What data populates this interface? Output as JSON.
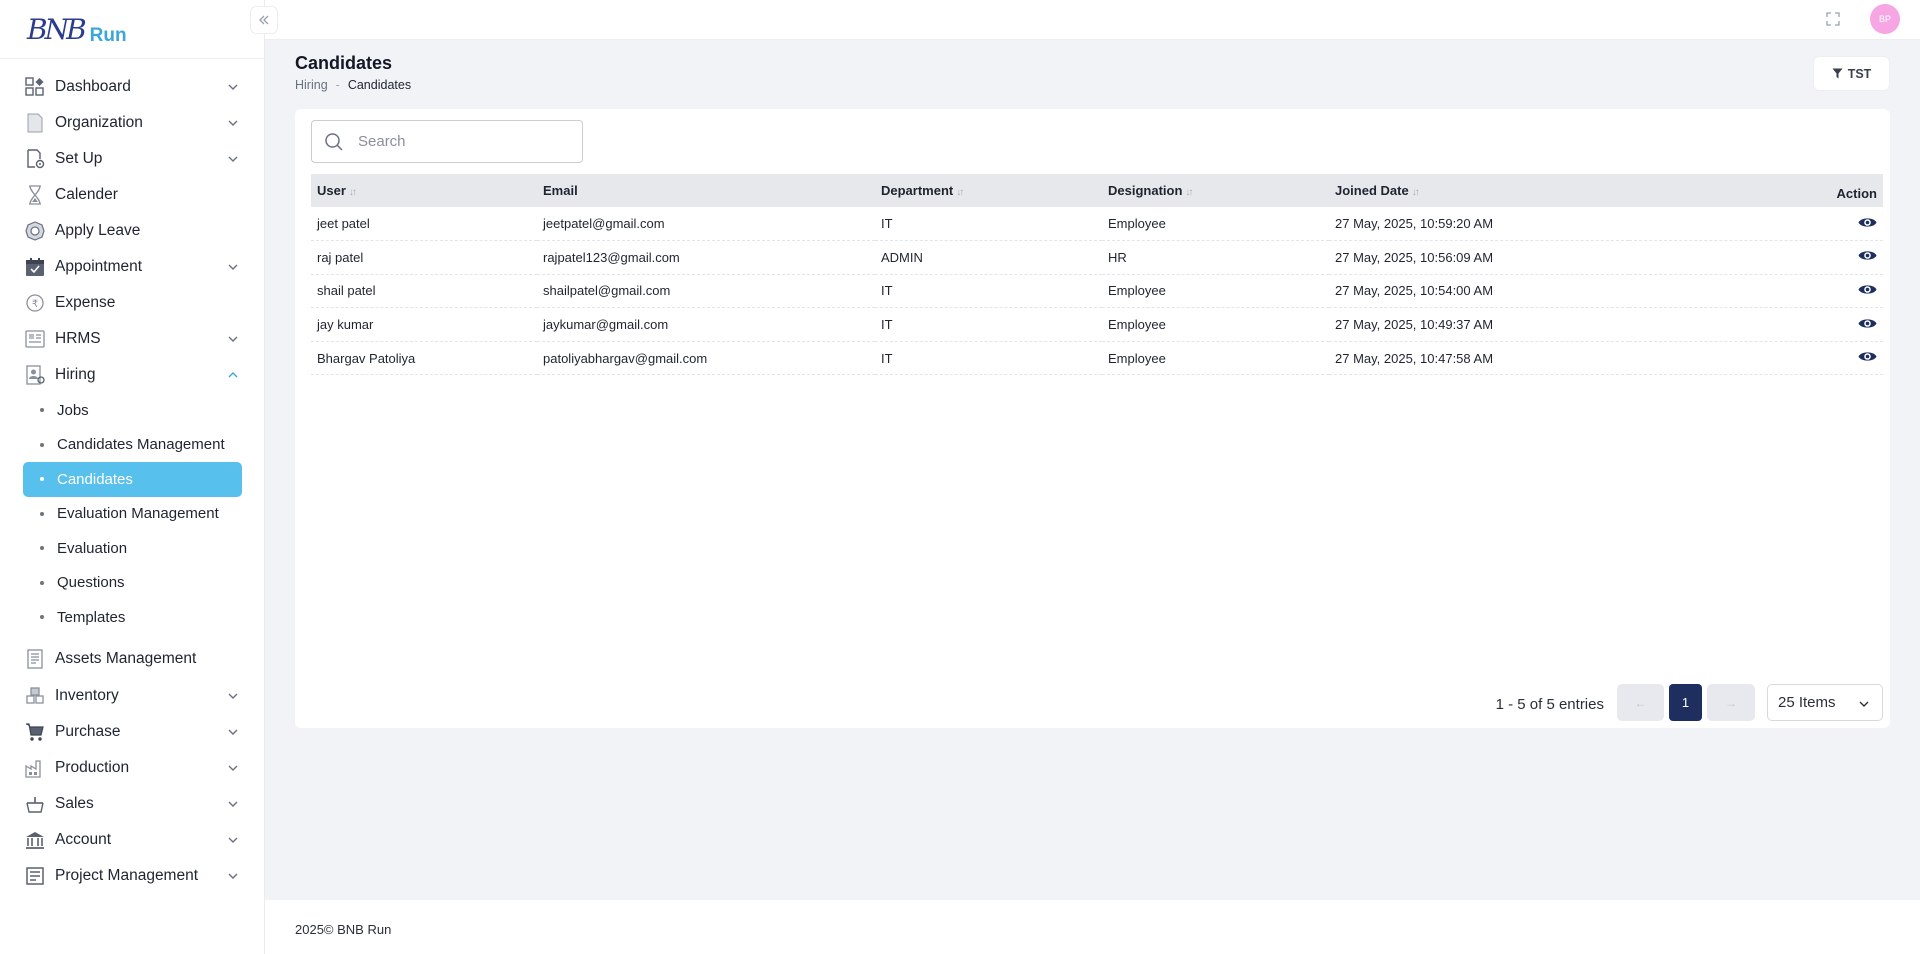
{
  "brand": {
    "mark": "BNB",
    "name": "Run"
  },
  "sidebar": {
    "items": [
      {
        "label": "Dashboard",
        "icon": "dashboard-icon",
        "has_chevron": true
      },
      {
        "label": "Organization",
        "icon": "organization-icon",
        "has_chevron": true
      },
      {
        "label": "Set Up",
        "icon": "setup-icon",
        "has_chevron": true
      },
      {
        "label": "Calender",
        "icon": "hourglass-icon",
        "has_chevron": false
      },
      {
        "label": "Apply Leave",
        "icon": "leave-icon",
        "has_chevron": false
      },
      {
        "label": "Appointment",
        "icon": "calendar-icon",
        "has_chevron": true
      },
      {
        "label": "Expense",
        "icon": "expense-icon",
        "has_chevron": false
      },
      {
        "label": "HRMS",
        "icon": "hrms-icon",
        "has_chevron": true
      },
      {
        "label": "Hiring",
        "icon": "hiring-icon",
        "has_chevron": true,
        "expanded": true
      }
    ],
    "hiring_sub": [
      {
        "label": "Jobs"
      },
      {
        "label": "Candidates Management"
      },
      {
        "label": "Candidates",
        "active": true
      },
      {
        "label": "Evaluation Management"
      },
      {
        "label": "Evaluation"
      },
      {
        "label": "Questions"
      },
      {
        "label": "Templates"
      }
    ],
    "items_after": [
      {
        "label": "Assets Management",
        "icon": "assets-icon",
        "has_chevron": false
      },
      {
        "label": "Inventory",
        "icon": "inventory-icon",
        "has_chevron": true
      },
      {
        "label": "Purchase",
        "icon": "cart-icon",
        "has_chevron": true
      },
      {
        "label": "Production",
        "icon": "factory-icon",
        "has_chevron": true
      },
      {
        "label": "Sales",
        "icon": "sales-icon",
        "has_chevron": true
      },
      {
        "label": "Account",
        "icon": "bank-icon",
        "has_chevron": true
      },
      {
        "label": "Project Management",
        "icon": "project-icon",
        "has_chevron": true
      }
    ]
  },
  "topbar": {
    "avatar_initials": "BP",
    "avatar_color": "#f5a6e3"
  },
  "page": {
    "title": "Candidates",
    "breadcrumb": {
      "parent": "Hiring",
      "separator": "-",
      "current": "Candidates"
    },
    "filter_label": "TST"
  },
  "search": {
    "placeholder": "Search",
    "value": ""
  },
  "table": {
    "columns": [
      "User",
      "Email",
      "Department",
      "Designation",
      "Joined Date",
      "Action"
    ],
    "rows": [
      {
        "user": "jeet patel",
        "email": "jeetpatel@gmail.com",
        "department": "IT",
        "designation": "Employee",
        "joined": "27 May, 2025, 10:59:20 AM"
      },
      {
        "user": "raj patel",
        "email": "rajpatel123@gmail.com",
        "department": "ADMIN",
        "designation": "HR",
        "joined": "27 May, 2025, 10:56:09 AM"
      },
      {
        "user": "shail patel",
        "email": "shailpatel@gmail.com",
        "department": "IT",
        "designation": "Employee",
        "joined": "27 May, 2025, 10:54:00 AM"
      },
      {
        "user": "jay kumar",
        "email": "jaykumar@gmail.com",
        "department": "IT",
        "designation": "Employee",
        "joined": "27 May, 2025, 10:49:37 AM"
      },
      {
        "user": "Bhargav Patoliya",
        "email": "patoliyabhargav@gmail.com",
        "department": "IT",
        "designation": "Employee",
        "joined": "27 May, 2025, 10:47:58 AM"
      }
    ]
  },
  "pagination": {
    "summary": "1 - 5 of 5 entries",
    "prev": "←",
    "current_page": "1",
    "next": "→",
    "page_size": "25 Items"
  },
  "footer": {
    "copyright": "2025© BNB Run"
  },
  "colors": {
    "active_nav": "#58c0ec",
    "page_btn": "#1e2f5f",
    "view_icon": "#1e2f5f"
  }
}
